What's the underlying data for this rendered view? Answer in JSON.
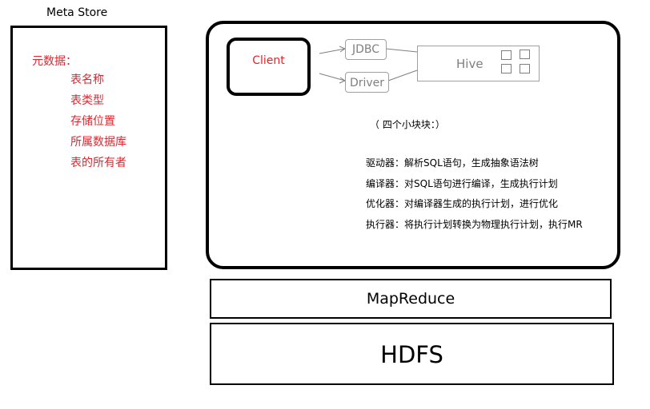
{
  "meta_store": {
    "title": "Meta Store",
    "heading": "元数据：",
    "items": [
      "表名称",
      "表类型",
      "存储位置",
      "所属数据库",
      "表的所有者"
    ]
  },
  "hive": {
    "client_label": "Client",
    "jdbc_label": "JDBC",
    "driver_label": "Driver",
    "hive_label": "Hive",
    "note": "（ 四个小块块：）",
    "descriptions": [
      "驱动器：解析SQL语句，生成抽象语法树",
      "编译器：对SQL语句进行编译，生成执行计划",
      "优化器：对编译器生成的执行计划，进行优化",
      "执行器：将执行计划转换为物理执行计划，执行MR"
    ]
  },
  "layers": {
    "mapreduce": "MapReduce",
    "hdfs": "HDFS"
  },
  "colors": {
    "metadata_text": "#e0252e",
    "client_text": "#e0252e",
    "component_gray": "#7f7f7f"
  }
}
